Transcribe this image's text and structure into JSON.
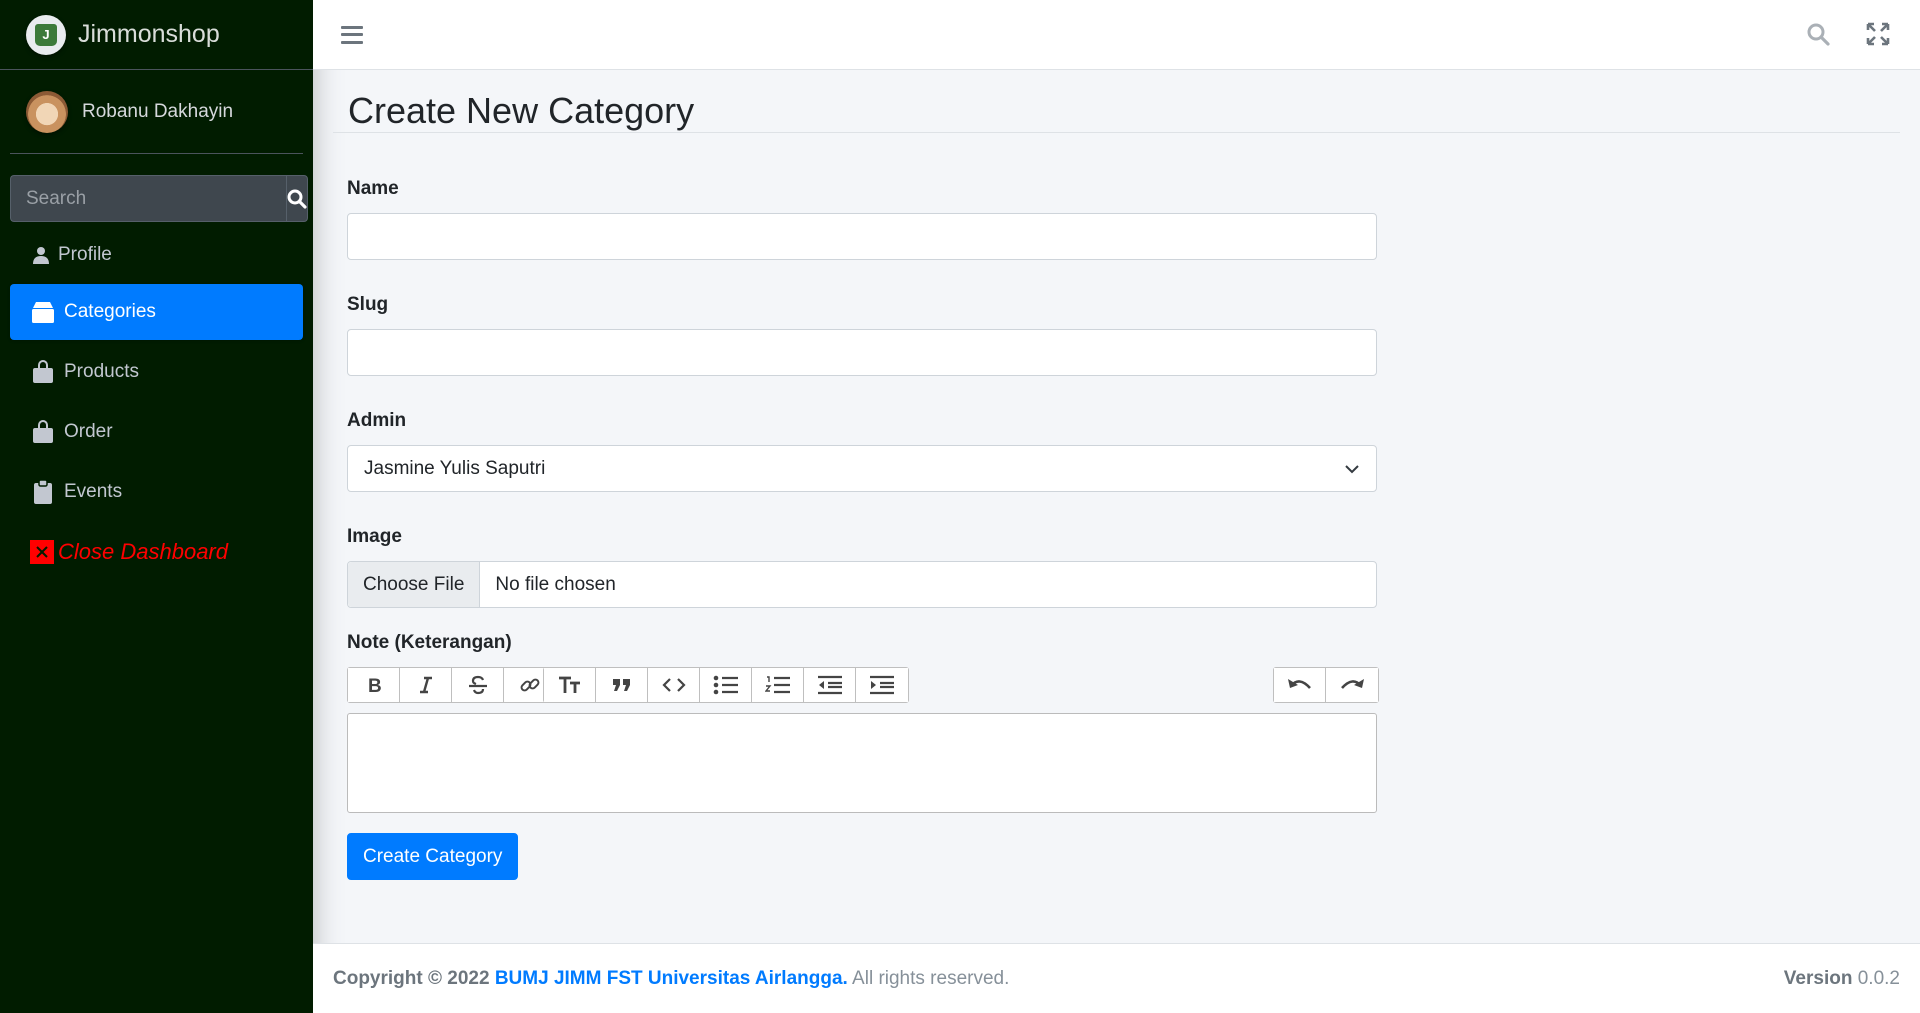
{
  "brand": {
    "name": "Jimmonshop",
    "logo_letter": "J"
  },
  "user": {
    "name": "Robanu Dakhayin"
  },
  "search": {
    "placeholder": "Search"
  },
  "nav": {
    "profile": "Profile",
    "categories": "Categories",
    "products": "Products",
    "order": "Order",
    "events": "Events",
    "close": "Close Dashboard"
  },
  "page": {
    "title": "Create New Category"
  },
  "form": {
    "name_label": "Name",
    "slug_label": "Slug",
    "admin_label": "Admin",
    "admin_selected": "Jasmine Yulis Saputri",
    "image_label": "Image",
    "file_button": "Choose File",
    "file_status": "No file chosen",
    "note_label": "Note (Keterangan)",
    "submit_label": "Create Category"
  },
  "toolbar": {
    "group1": [
      "bold-icon",
      "italic-icon",
      "strikethrough-icon",
      "link-icon"
    ],
    "group2": [
      "heading-icon",
      "quote-icon",
      "code-icon",
      "bullet-list-icon",
      "numbered-list-icon",
      "outdent-icon",
      "indent-icon"
    ],
    "group3": [
      "undo-icon",
      "redo-icon"
    ]
  },
  "footer": {
    "copyright_prefix": "Copyright © 2022",
    "org": "BUMJ JIMM FST Universitas Airlangga.",
    "rights": "All rights reserved.",
    "version_label": "Version",
    "version": "0.0.2"
  },
  "colors": {
    "sidebar": "#011c00",
    "accent": "#007bff",
    "danger": "#ff0000"
  }
}
